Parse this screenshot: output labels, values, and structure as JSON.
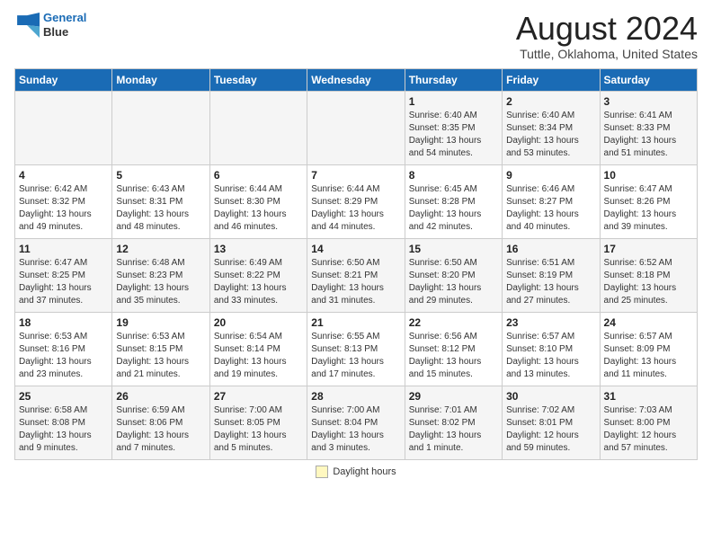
{
  "header": {
    "logo_line1": "General",
    "logo_line2": "Blue",
    "month": "August 2024",
    "location": "Tuttle, Oklahoma, United States"
  },
  "days_of_week": [
    "Sunday",
    "Monday",
    "Tuesday",
    "Wednesday",
    "Thursday",
    "Friday",
    "Saturday"
  ],
  "weeks": [
    [
      {
        "day": "",
        "info": ""
      },
      {
        "day": "",
        "info": ""
      },
      {
        "day": "",
        "info": ""
      },
      {
        "day": "",
        "info": ""
      },
      {
        "day": "1",
        "info": "Sunrise: 6:40 AM\nSunset: 8:35 PM\nDaylight: 13 hours\nand 54 minutes."
      },
      {
        "day": "2",
        "info": "Sunrise: 6:40 AM\nSunset: 8:34 PM\nDaylight: 13 hours\nand 53 minutes."
      },
      {
        "day": "3",
        "info": "Sunrise: 6:41 AM\nSunset: 8:33 PM\nDaylight: 13 hours\nand 51 minutes."
      }
    ],
    [
      {
        "day": "4",
        "info": "Sunrise: 6:42 AM\nSunset: 8:32 PM\nDaylight: 13 hours\nand 49 minutes."
      },
      {
        "day": "5",
        "info": "Sunrise: 6:43 AM\nSunset: 8:31 PM\nDaylight: 13 hours\nand 48 minutes."
      },
      {
        "day": "6",
        "info": "Sunrise: 6:44 AM\nSunset: 8:30 PM\nDaylight: 13 hours\nand 46 minutes."
      },
      {
        "day": "7",
        "info": "Sunrise: 6:44 AM\nSunset: 8:29 PM\nDaylight: 13 hours\nand 44 minutes."
      },
      {
        "day": "8",
        "info": "Sunrise: 6:45 AM\nSunset: 8:28 PM\nDaylight: 13 hours\nand 42 minutes."
      },
      {
        "day": "9",
        "info": "Sunrise: 6:46 AM\nSunset: 8:27 PM\nDaylight: 13 hours\nand 40 minutes."
      },
      {
        "day": "10",
        "info": "Sunrise: 6:47 AM\nSunset: 8:26 PM\nDaylight: 13 hours\nand 39 minutes."
      }
    ],
    [
      {
        "day": "11",
        "info": "Sunrise: 6:47 AM\nSunset: 8:25 PM\nDaylight: 13 hours\nand 37 minutes."
      },
      {
        "day": "12",
        "info": "Sunrise: 6:48 AM\nSunset: 8:23 PM\nDaylight: 13 hours\nand 35 minutes."
      },
      {
        "day": "13",
        "info": "Sunrise: 6:49 AM\nSunset: 8:22 PM\nDaylight: 13 hours\nand 33 minutes."
      },
      {
        "day": "14",
        "info": "Sunrise: 6:50 AM\nSunset: 8:21 PM\nDaylight: 13 hours\nand 31 minutes."
      },
      {
        "day": "15",
        "info": "Sunrise: 6:50 AM\nSunset: 8:20 PM\nDaylight: 13 hours\nand 29 minutes."
      },
      {
        "day": "16",
        "info": "Sunrise: 6:51 AM\nSunset: 8:19 PM\nDaylight: 13 hours\nand 27 minutes."
      },
      {
        "day": "17",
        "info": "Sunrise: 6:52 AM\nSunset: 8:18 PM\nDaylight: 13 hours\nand 25 minutes."
      }
    ],
    [
      {
        "day": "18",
        "info": "Sunrise: 6:53 AM\nSunset: 8:16 PM\nDaylight: 13 hours\nand 23 minutes."
      },
      {
        "day": "19",
        "info": "Sunrise: 6:53 AM\nSunset: 8:15 PM\nDaylight: 13 hours\nand 21 minutes."
      },
      {
        "day": "20",
        "info": "Sunrise: 6:54 AM\nSunset: 8:14 PM\nDaylight: 13 hours\nand 19 minutes."
      },
      {
        "day": "21",
        "info": "Sunrise: 6:55 AM\nSunset: 8:13 PM\nDaylight: 13 hours\nand 17 minutes."
      },
      {
        "day": "22",
        "info": "Sunrise: 6:56 AM\nSunset: 8:12 PM\nDaylight: 13 hours\nand 15 minutes."
      },
      {
        "day": "23",
        "info": "Sunrise: 6:57 AM\nSunset: 8:10 PM\nDaylight: 13 hours\nand 13 minutes."
      },
      {
        "day": "24",
        "info": "Sunrise: 6:57 AM\nSunset: 8:09 PM\nDaylight: 13 hours\nand 11 minutes."
      }
    ],
    [
      {
        "day": "25",
        "info": "Sunrise: 6:58 AM\nSunset: 8:08 PM\nDaylight: 13 hours\nand 9 minutes."
      },
      {
        "day": "26",
        "info": "Sunrise: 6:59 AM\nSunset: 8:06 PM\nDaylight: 13 hours\nand 7 minutes."
      },
      {
        "day": "27",
        "info": "Sunrise: 7:00 AM\nSunset: 8:05 PM\nDaylight: 13 hours\nand 5 minutes."
      },
      {
        "day": "28",
        "info": "Sunrise: 7:00 AM\nSunset: 8:04 PM\nDaylight: 13 hours\nand 3 minutes."
      },
      {
        "day": "29",
        "info": "Sunrise: 7:01 AM\nSunset: 8:02 PM\nDaylight: 13 hours\nand 1 minute."
      },
      {
        "day": "30",
        "info": "Sunrise: 7:02 AM\nSunset: 8:01 PM\nDaylight: 12 hours\nand 59 minutes."
      },
      {
        "day": "31",
        "info": "Sunrise: 7:03 AM\nSunset: 8:00 PM\nDaylight: 12 hours\nand 57 minutes."
      }
    ]
  ],
  "legend": {
    "daylight_color": "#fff8c0",
    "daylight_label": "Daylight hours"
  }
}
